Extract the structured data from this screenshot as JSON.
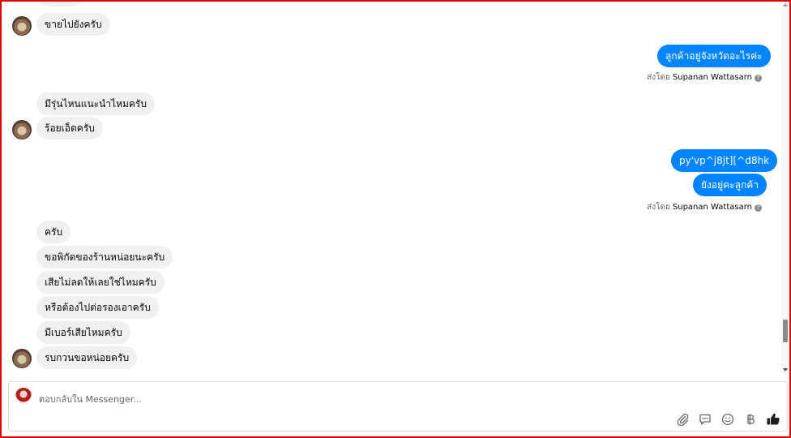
{
  "messages": {
    "m1": "ขายไปยังครับ",
    "m2": "ลูกค้าอยู่จังหวัดอะไรค่ะ",
    "m3": "มีรุ่นไหนแนะนำไหมครับ",
    "m4": "ร้อยเอ็ดครับ",
    "m5": "py'vp^j8jt][^d8hk",
    "m6": "ยังอยู่คะลูกค้า",
    "m7": "ครับ",
    "m8": "ขอพิกัดของร้านหน่อยนะครับ",
    "m9": "เสียไม่ลดให้เลยใช่ไหมครับ",
    "m10": "หรือต้องไปต่อรองเอาครับ",
    "m11": "มีเบอร์เสียไหมครับ",
    "m12": "รบกวนขอหน่อยครับ"
  },
  "sent_by": {
    "prefix": "ส่งโดย",
    "name": "Supanan Wattasarn"
  },
  "composer": {
    "placeholder": "ตอบกลับใน Messenger..."
  },
  "colors": {
    "outgoing": "#0084ff",
    "incoming": "#f0f0f0",
    "frame": "#e00000"
  }
}
